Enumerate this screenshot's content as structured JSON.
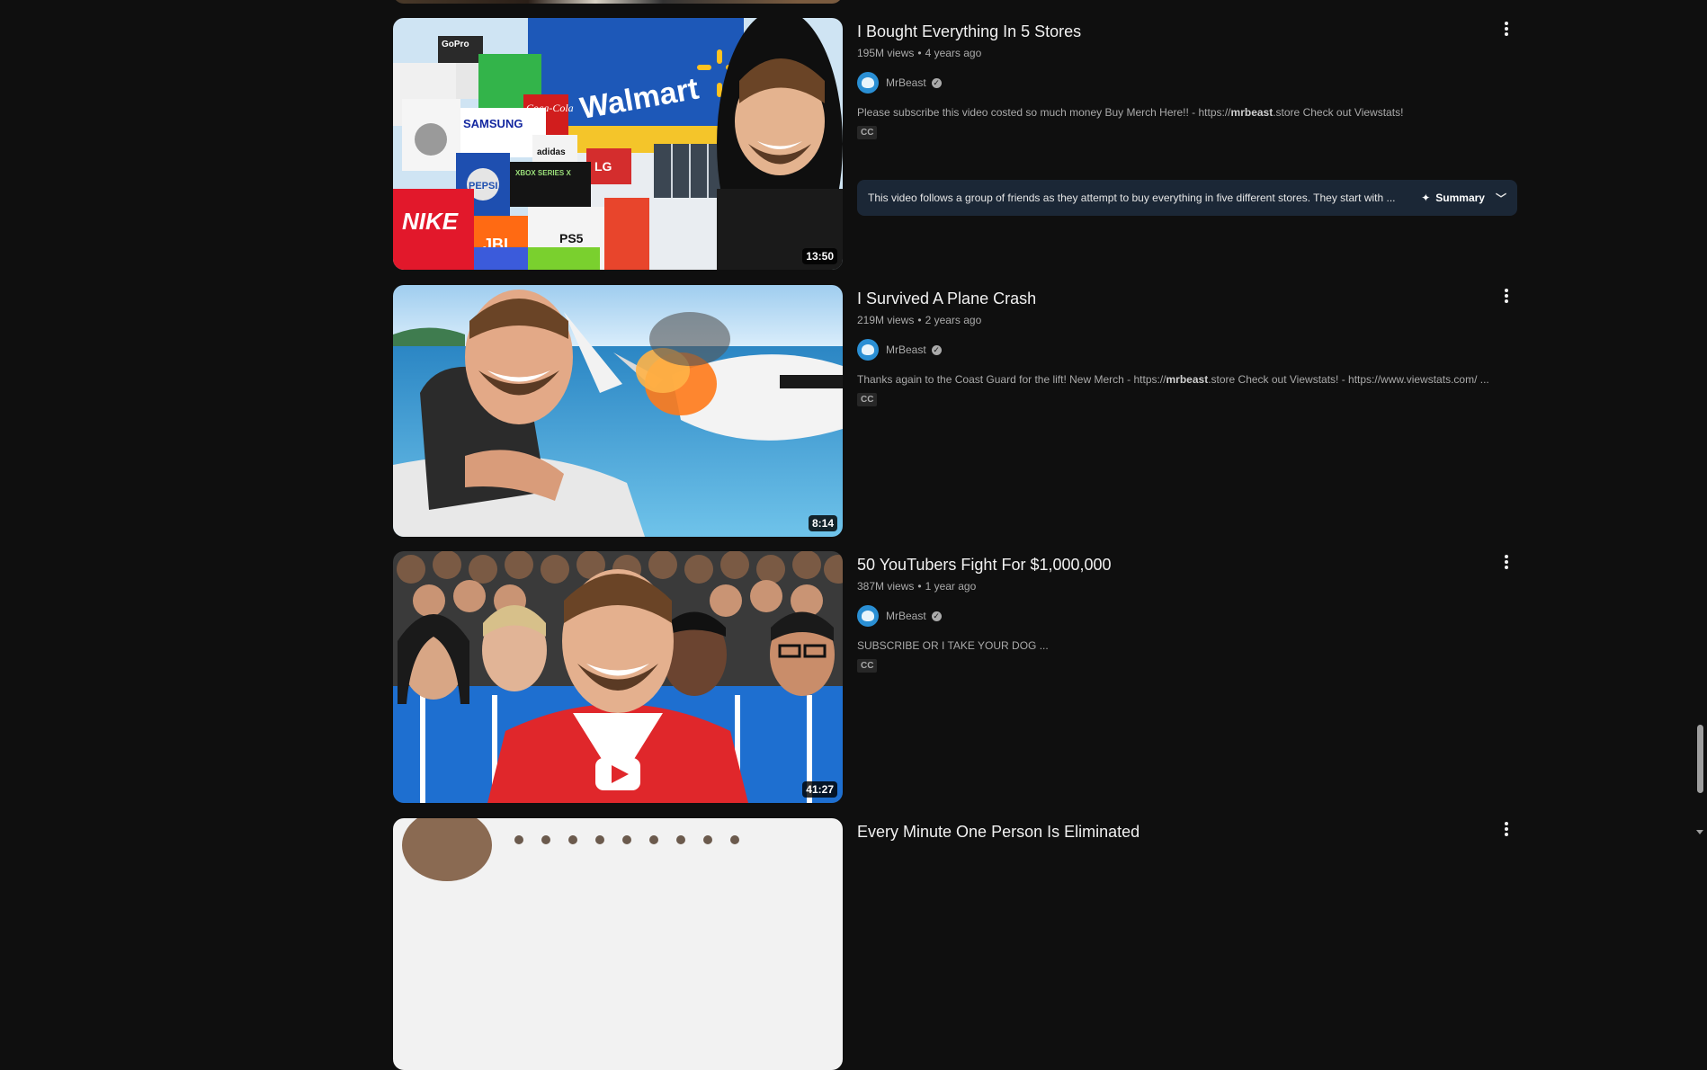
{
  "videos": [
    {
      "title": "I Bought Everything In 5 Stores",
      "views": "195M views",
      "age": "4 years ago",
      "channel": "MrBeast",
      "description_prefix": "Please subscribe this video costed so much money Buy Merch Here!! - https://",
      "description_bold": "mrbeast",
      "description_suffix": ".store Check out Viewstats!",
      "cc": "CC",
      "duration": "13:50",
      "summary_text": "This video follows a group of friends as they attempt to buy everything in five different stores. They start with ...",
      "summary_label": "Summary",
      "thumb_text": {
        "store": "Walmart",
        "brand1": "GoPro",
        "brand2": "SAMSUNG",
        "brand3": "PEPSI",
        "brand4": "NIKE",
        "brand5": "LG",
        "brand6": "JBL",
        "brand7": "PS5",
        "brand8": "XBOX SERIES X",
        "brand9": "adidas",
        "brand10": "Coca-Cola"
      }
    },
    {
      "title": "I Survived A Plane Crash",
      "views": "219M views",
      "age": "2 years ago",
      "channel": "MrBeast",
      "description_prefix": "Thanks again to the Coast Guard for the lift! New Merch - https://",
      "description_bold": "mrbeast",
      "description_suffix": ".store Check out Viewstats! - https://www.viewstats.com/ ...",
      "cc": "CC",
      "duration": "8:14"
    },
    {
      "title": "50 YouTubers Fight For $1,000,000",
      "views": "387M views",
      "age": "1 year ago",
      "channel": "MrBeast",
      "description_prefix": "SUBSCRIBE OR I TAKE YOUR DOG ...",
      "cc": "CC",
      "duration": "41:27"
    },
    {
      "title": "Every Minute One Person Is Eliminated"
    }
  ],
  "icons": {
    "more": "more-vert-icon",
    "verified": "verified-check-icon",
    "sparkle": "sparkle-icon",
    "chevron": "chevron-down-icon"
  },
  "colors": {
    "background": "#0f0f0f",
    "summary_bg": "#1b2736",
    "meta_text": "#aaaaaa"
  }
}
